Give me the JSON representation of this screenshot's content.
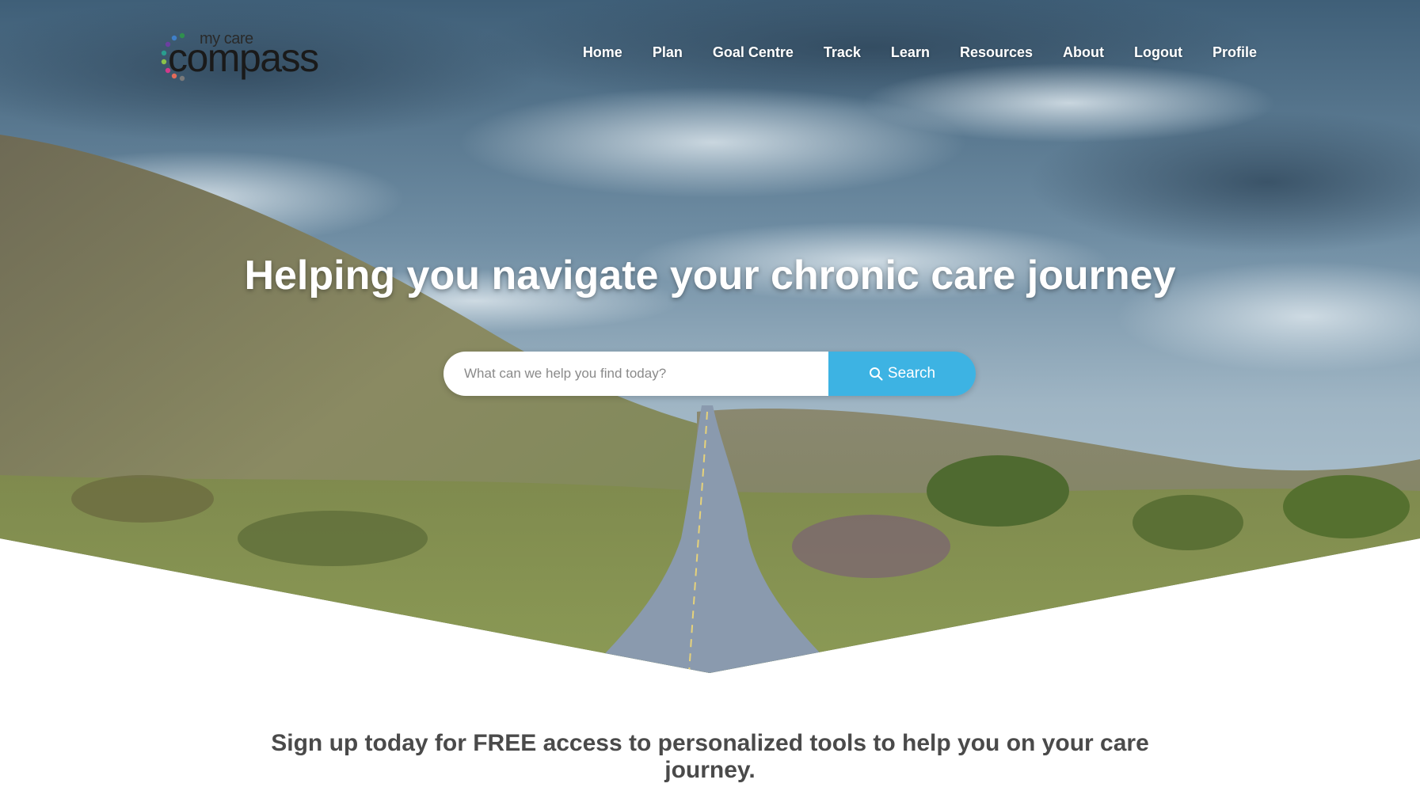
{
  "brand": {
    "logo_small": "my care",
    "logo_large": "compass",
    "dot_colors": [
      "#2f8f4e",
      "#3f7fc8",
      "#6b3fa0",
      "#d03a8a",
      "#e26b5a",
      "#7a7a7a",
      "#2a9d8f",
      "#8bc34a"
    ]
  },
  "nav": {
    "items": [
      {
        "label": "Home"
      },
      {
        "label": "Plan"
      },
      {
        "label": "Goal Centre"
      },
      {
        "label": "Track"
      },
      {
        "label": "Learn"
      },
      {
        "label": "Resources"
      },
      {
        "label": "About"
      },
      {
        "label": "Logout"
      },
      {
        "label": "Profile"
      }
    ]
  },
  "hero": {
    "title": "Helping you navigate your chronic care journey"
  },
  "search": {
    "placeholder": "What can we help you find today?",
    "value": "",
    "button_label": "Search",
    "button_color": "#3db3e3"
  },
  "signup": {
    "text": "Sign up today for FREE access to personalized tools to help you on your care journey."
  }
}
